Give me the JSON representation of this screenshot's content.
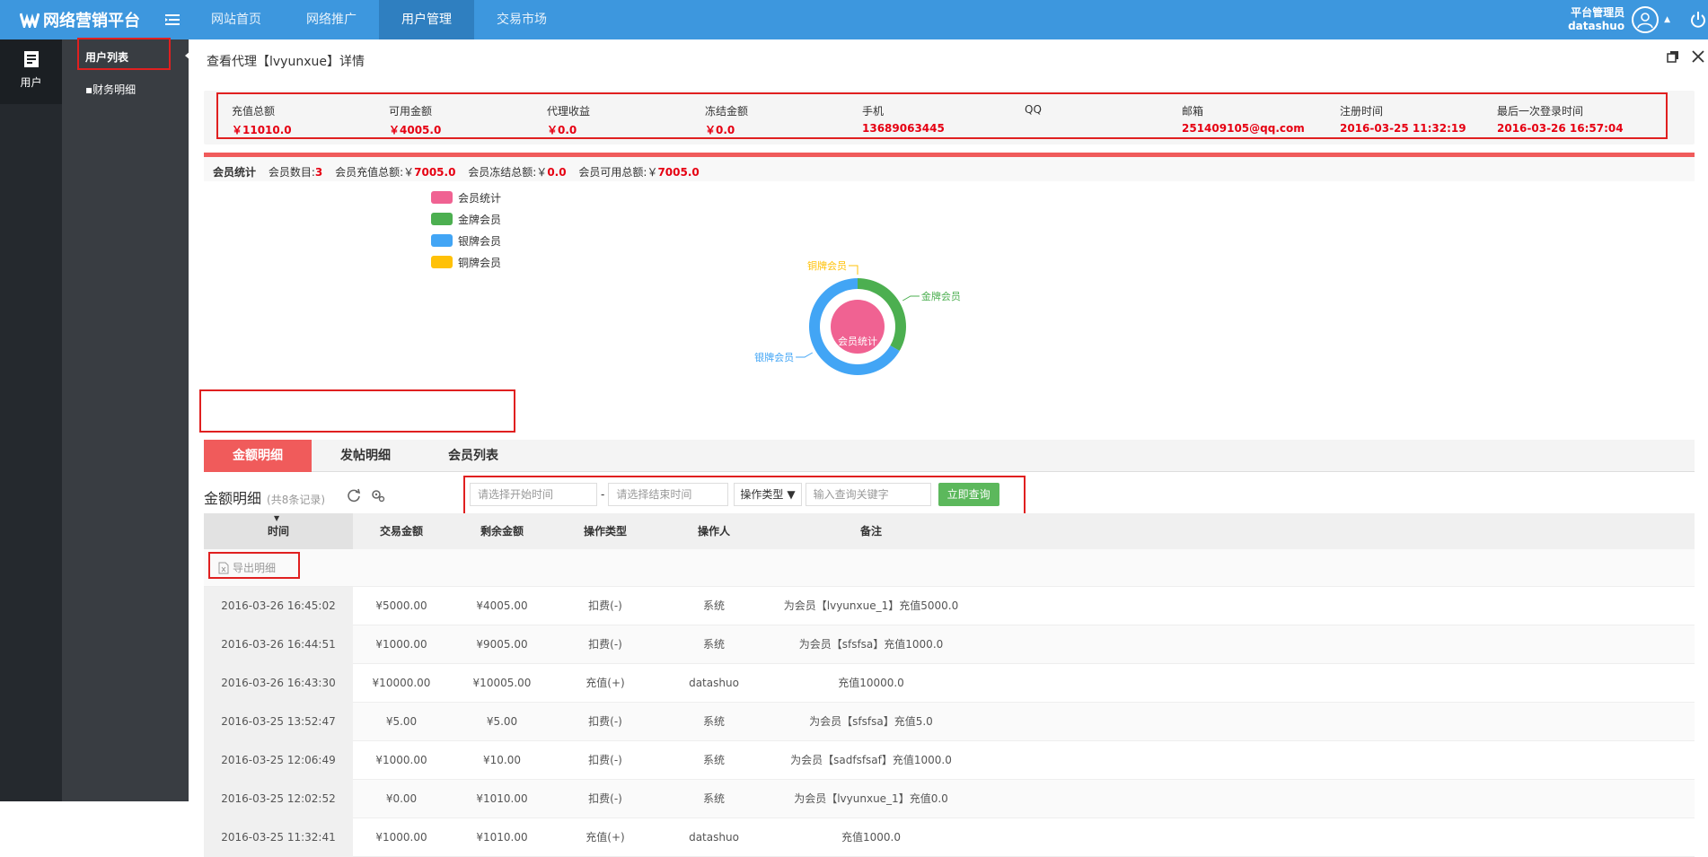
{
  "header": {
    "logo_text": "网络营销平台",
    "nav": [
      "网站首页",
      "网络推广",
      "用户管理",
      "交易市场"
    ],
    "active_nav": 2,
    "user_role": "平台管理员",
    "user_name": "datashuo"
  },
  "rail": {
    "label": "用户"
  },
  "subnav": {
    "items": [
      "用户列表",
      "财务明细"
    ]
  },
  "page": {
    "title": "查看代理【lvyunxue】详情"
  },
  "stats": [
    {
      "label": "充值总额",
      "value": "￥11010.0"
    },
    {
      "label": "可用金额",
      "value": "￥4005.0"
    },
    {
      "label": "代理收益",
      "value": "￥0.0"
    },
    {
      "label": "冻结金额",
      "value": "￥0.0"
    },
    {
      "label": "手机",
      "value": "13689063445"
    },
    {
      "label": "QQ",
      "value": ""
    },
    {
      "label": "邮箱",
      "value": "251409105@qq.com"
    },
    {
      "label": "注册时间",
      "value": "2016-03-25 11:32:19"
    },
    {
      "label": "最后一次登录时间",
      "value": "2016-03-26 16:57:04"
    }
  ],
  "member_stats": {
    "title": "会员统计",
    "count_label": "会员数目:",
    "count_value": "3",
    "recharge_label": "会员充值总额:￥",
    "recharge_value": "7005.0",
    "frozen_label": "会员冻结总额:￥",
    "frozen_value": "0.0",
    "available_label": "会员可用总额:￥",
    "available_value": "7005.0"
  },
  "chart_data": {
    "type": "pie",
    "legend": [
      "会员统计",
      "金牌会员",
      "银牌会员",
      "铜牌会员"
    ],
    "colors": {
      "会员统计": "#f06292",
      "金牌会员": "#4caf50",
      "银牌会员": "#42a5f5",
      "铜牌会员": "#ffc107"
    },
    "inner": {
      "name": "会员统计",
      "value": 3
    },
    "outer": [
      {
        "name": "金牌会员",
        "value": 1
      },
      {
        "name": "银牌会员",
        "value": 2
      },
      {
        "name": "铜牌会员",
        "value": 0
      }
    ],
    "center_label": "会员统计",
    "legend_position": "top-left"
  },
  "tabs": [
    "金额明细",
    "发帖明细",
    "会员列表"
  ],
  "active_tab": 0,
  "toolbar": {
    "title": "金额明细",
    "count": "(共8条记录)",
    "start_placeholder": "请选择开始时间",
    "end_placeholder": "请选择结束时间",
    "separator": "-",
    "op_type": "操作类型",
    "keyword_placeholder": "输入查询关键字",
    "search_btn": "立即查询"
  },
  "table": {
    "columns": [
      "时间",
      "交易金额",
      "剩余金额",
      "操作类型",
      "操作人",
      "备注"
    ],
    "export_label": "导出明细",
    "rows": [
      [
        "2016-03-26 16:45:02",
        "¥5000.00",
        "¥4005.00",
        "扣费(-)",
        "系统",
        "为会员【lvyunxue_1】充值5000.0"
      ],
      [
        "2016-03-26 16:44:51",
        "¥1000.00",
        "¥9005.00",
        "扣费(-)",
        "系统",
        "为会员【sfsfsa】充值1000.0"
      ],
      [
        "2016-03-26 16:43:30",
        "¥10000.00",
        "¥10005.00",
        "充值(+)",
        "datashuo",
        "充值10000.0"
      ],
      [
        "2016-03-25 13:52:47",
        "¥5.00",
        "¥5.00",
        "扣费(-)",
        "系统",
        "为会员【sfsfsa】充值5.0"
      ],
      [
        "2016-03-25 12:06:49",
        "¥1000.00",
        "¥10.00",
        "扣费(-)",
        "系统",
        "为会员【sadfsfsaf】充值1000.0"
      ],
      [
        "2016-03-25 12:02:52",
        "¥0.00",
        "¥1010.00",
        "扣费(-)",
        "系统",
        "为会员【lvyunxue_1】充值0.0"
      ],
      [
        "2016-03-25 11:32:41",
        "¥1000.00",
        "¥1010.00",
        "充值(+)",
        "datashuo",
        "充值1000.0"
      ]
    ]
  }
}
